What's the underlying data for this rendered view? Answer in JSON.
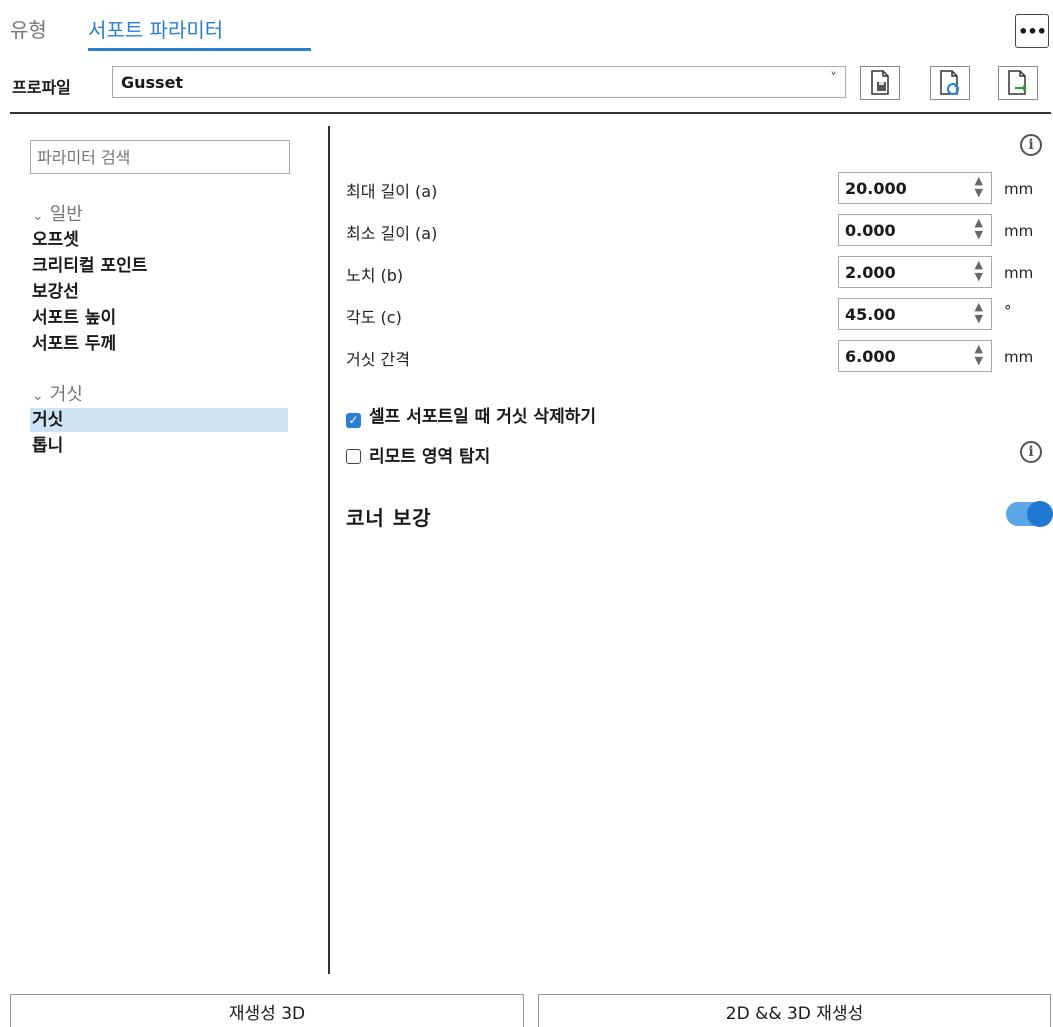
{
  "tabs": {
    "type_label": "유형",
    "support_label": "서포트 파라미터",
    "more_label": "•••"
  },
  "profile": {
    "label": "프로파일",
    "value": "Gusset",
    "caret": "˅",
    "buttons": [
      {
        "icon": "page-save-icon"
      },
      {
        "icon": "page-refresh-icon"
      },
      {
        "icon": "page-export-icon"
      }
    ]
  },
  "sidebar": {
    "search_placeholder": "파라미터 검색",
    "groups": [
      {
        "label": "일반",
        "items": [
          "오프셋",
          "크리티컬 포인트",
          "보강선",
          "서포트 높이",
          "서포트 두께"
        ]
      },
      {
        "label": "거싯",
        "items": [
          "거싯",
          "톱니"
        ],
        "selected": "거싯"
      }
    ]
  },
  "params": [
    {
      "label": "최대 길이 (a)",
      "value": "20.000",
      "unit": "mm"
    },
    {
      "label": "최소 길이 (a)",
      "value": "0.000",
      "unit": "mm"
    },
    {
      "label": "노치 (b)",
      "value": "2.000",
      "unit": "mm"
    },
    {
      "label": "각도 (c)",
      "value": "45.00",
      "unit": "°"
    },
    {
      "label": "거싯 간격",
      "value": "6.000",
      "unit": "mm"
    }
  ],
  "checkboxes": [
    {
      "label": "셀프 서포트일 때 거싯 삭제하기",
      "checked": true
    },
    {
      "label": "리모트 영역 탐지",
      "checked": false
    }
  ],
  "corner": {
    "label": "코너 보강",
    "enabled": true
  },
  "colors": {
    "accent": "#2a7fd3",
    "selected_bg": "#cfe3f6",
    "toggle_on": "#1f78d1"
  },
  "buttons": {
    "regenerate_3d": "재생성 3D",
    "regenerate_2d3d": "2D && 3D 재생성"
  }
}
